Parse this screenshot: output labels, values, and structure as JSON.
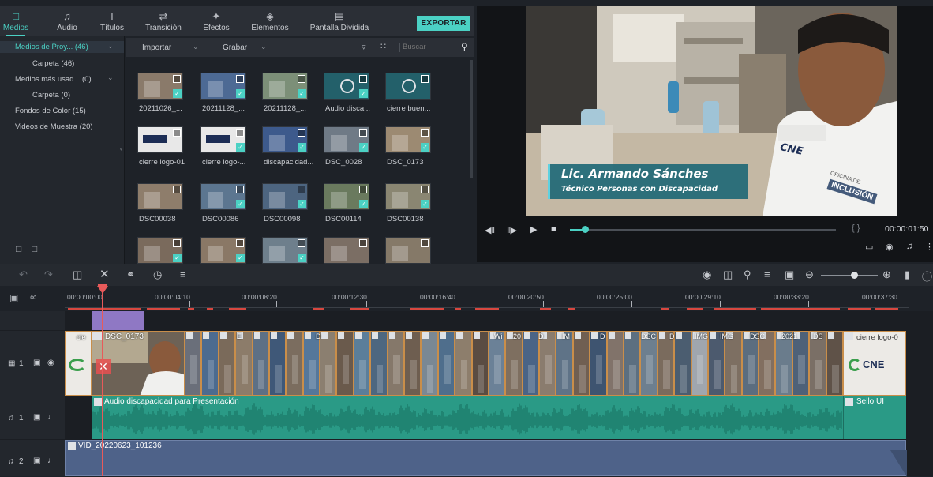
{
  "toolbar": {
    "tabs": [
      {
        "label": "Medios",
        "icon": "folder-icon",
        "active": true
      },
      {
        "label": "Audio",
        "icon": "music-note-icon",
        "active": false
      },
      {
        "label": "Títulos",
        "icon": "title-text-icon",
        "active": false
      },
      {
        "label": "Transición",
        "icon": "transition-icon",
        "active": false
      },
      {
        "label": "Efectos",
        "icon": "effects-icon",
        "active": false
      },
      {
        "label": "Elementos",
        "icon": "elements-icon",
        "active": false
      },
      {
        "label": "Pantalla Dividida",
        "icon": "split-screen-icon",
        "active": false
      }
    ],
    "export_label": "EXPORTAR",
    "accent_color": "#4bd1c4"
  },
  "sidebar": {
    "items": [
      {
        "label": "Medios de Proy... (46)",
        "selected": true
      },
      {
        "label": "Carpeta (46)"
      },
      {
        "label": "Medios más usad... (0)"
      },
      {
        "label": "Carpeta (0)"
      },
      {
        "label": "Fondos de Color (15)"
      },
      {
        "label": "Videos de Muestra (20)"
      }
    ]
  },
  "mediabar": {
    "import_label": "Importar",
    "record_label": "Grabar",
    "search_placeholder": "Buscar"
  },
  "media_items": [
    {
      "label": "20211026_...",
      "kind": "photo",
      "color": "#8a7a6a",
      "checked": true
    },
    {
      "label": "20211128_...",
      "kind": "photo",
      "color": "#4d6a94",
      "checked": true
    },
    {
      "label": "20211128_...",
      "kind": "photo",
      "color": "#7c8f78",
      "checked": true
    },
    {
      "label": "Audio disca...",
      "kind": "audio",
      "color": "#23606a",
      "checked": true
    },
    {
      "label": "cierre buen...",
      "kind": "audio",
      "color": "#23606a",
      "checked": false
    },
    {
      "label": "cierre logo-01",
      "kind": "logo",
      "color": "#e8e8e8",
      "checked": false
    },
    {
      "label": "cierre logo-...",
      "kind": "logo",
      "color": "#e8e8e8",
      "checked": true
    },
    {
      "label": "discapacidad...",
      "kind": "photo",
      "color": "#3d5a8c",
      "checked": true
    },
    {
      "label": "DSC_0028",
      "kind": "photo",
      "color": "#6f7a86",
      "checked": true
    },
    {
      "label": "DSC_0173",
      "kind": "photo",
      "color": "#9c8a72",
      "checked": true
    },
    {
      "label": "DSC00038",
      "kind": "photo",
      "color": "#8e7d6b",
      "checked": false
    },
    {
      "label": "DSC00086",
      "kind": "photo",
      "color": "#5c7690",
      "checked": true
    },
    {
      "label": "DSC00098",
      "kind": "photo",
      "color": "#4d6580",
      "checked": true
    },
    {
      "label": "DSC00114",
      "kind": "photo",
      "color": "#6a7a5e",
      "checked": true
    },
    {
      "label": "DSC00138",
      "kind": "photo",
      "color": "#8a8672",
      "checked": true
    },
    {
      "label": "",
      "kind": "photo",
      "color": "#7a6a5c",
      "checked": true
    },
    {
      "label": "",
      "kind": "photo",
      "color": "#8a7866",
      "checked": true
    },
    {
      "label": "",
      "kind": "photo",
      "color": "#6e7f8c",
      "checked": true
    },
    {
      "label": "",
      "kind": "photo",
      "color": "#7b6e64",
      "checked": false
    },
    {
      "label": "",
      "kind": "photo",
      "color": "#857968",
      "checked": false
    }
  ],
  "preview": {
    "lower_third_name": "Lic. Armando Sánches",
    "lower_third_role": "Técnico Personas con Discapacidad",
    "shirt_logo": "CNE",
    "sleeve_text_top": "OFICINA DE",
    "sleeve_text_bottom": "INCLUSIÓN",
    "timecode": "00:00:01:50",
    "bracket_label": "{ }"
  },
  "ruler": {
    "ticks": [
      "00:00:00:00",
      "00:00:04:10",
      "00:00:08:20",
      "00:00:12:30",
      "00:00:16:40",
      "00:00:20:50",
      "00:00:25:00",
      "00:00:29:10",
      "00:00:33:20",
      "00:00:37:30"
    ]
  },
  "tracks": {
    "video1_label": "1",
    "audio1_label": "1",
    "audio2_label": "2",
    "video_clip_first": "DSC_0173",
    "video_clip_prefix": "cie",
    "video_clip_last": "cierre logo-0",
    "mid_clip_labels": [
      "E",
      "D",
      "Wi",
      "20",
      "D",
      "IM",
      "D",
      "DSC",
      "D",
      "IMG",
      "IMG",
      "DSC",
      "2021",
      "DS"
    ],
    "audio_clip_label": "Audio discapacidad para Presentación",
    "audio_clip_end_label": "Sello UI",
    "video2_clip_label": "VID_20220623_101236"
  }
}
